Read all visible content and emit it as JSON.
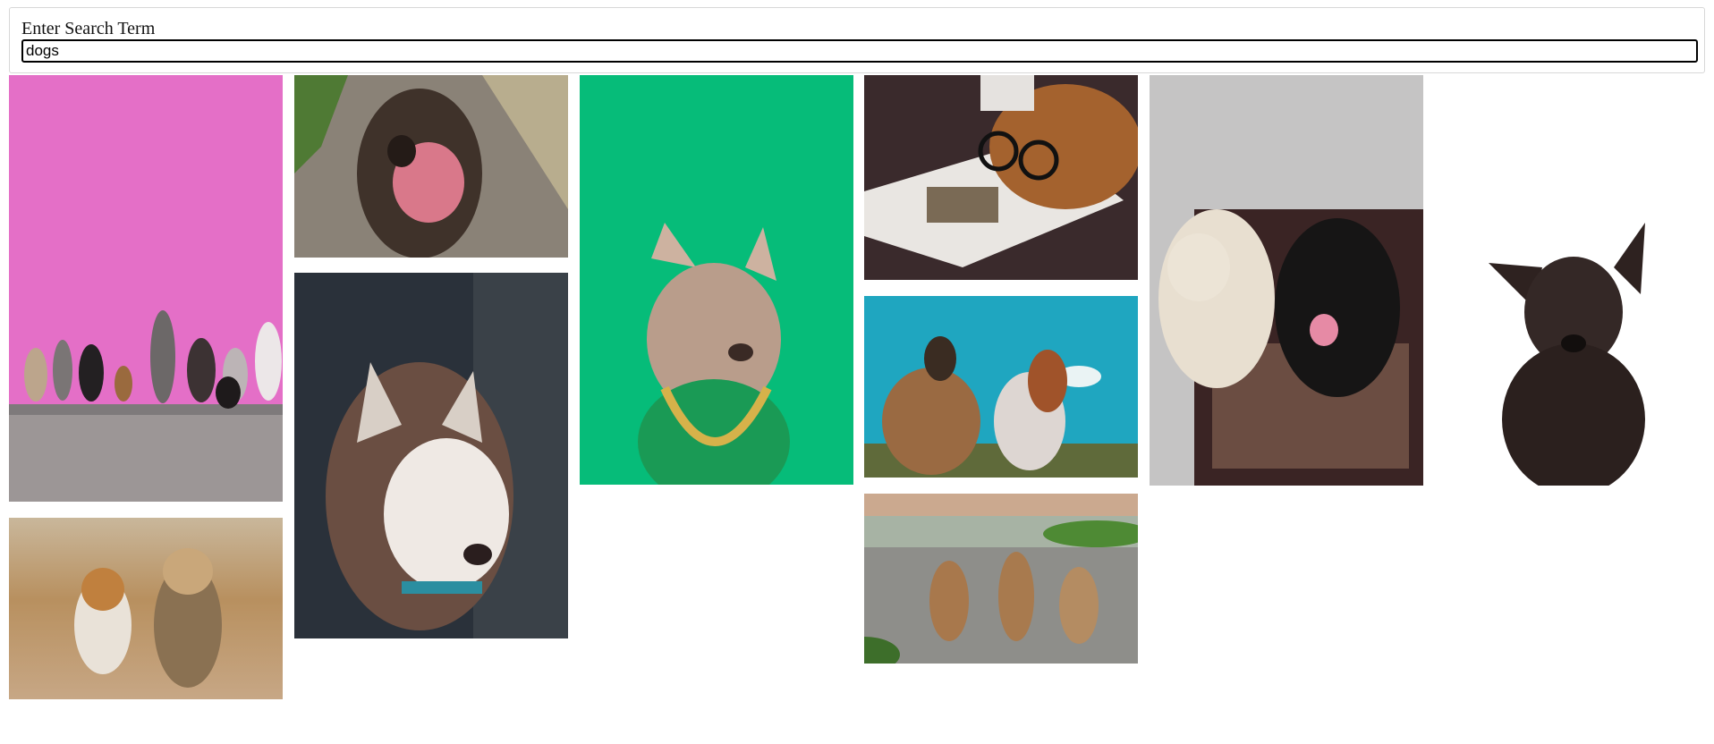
{
  "search": {
    "label": "Enter Search Term",
    "value": "dogs"
  },
  "results": [
    {
      "name": "dogs-row-pink-wall"
    },
    {
      "name": "corgi-and-yorkie-running"
    },
    {
      "name": "brown-dog-licking-nose"
    },
    {
      "name": "husky-portrait"
    },
    {
      "name": "french-bulldog-green-background"
    },
    {
      "name": "dog-with-glasses-reading"
    },
    {
      "name": "two-dogs-looking-up"
    },
    {
      "name": "three-puppies-on-road"
    },
    {
      "name": "two-dogs-on-rug"
    },
    {
      "name": "black-dog-white-background"
    }
  ]
}
